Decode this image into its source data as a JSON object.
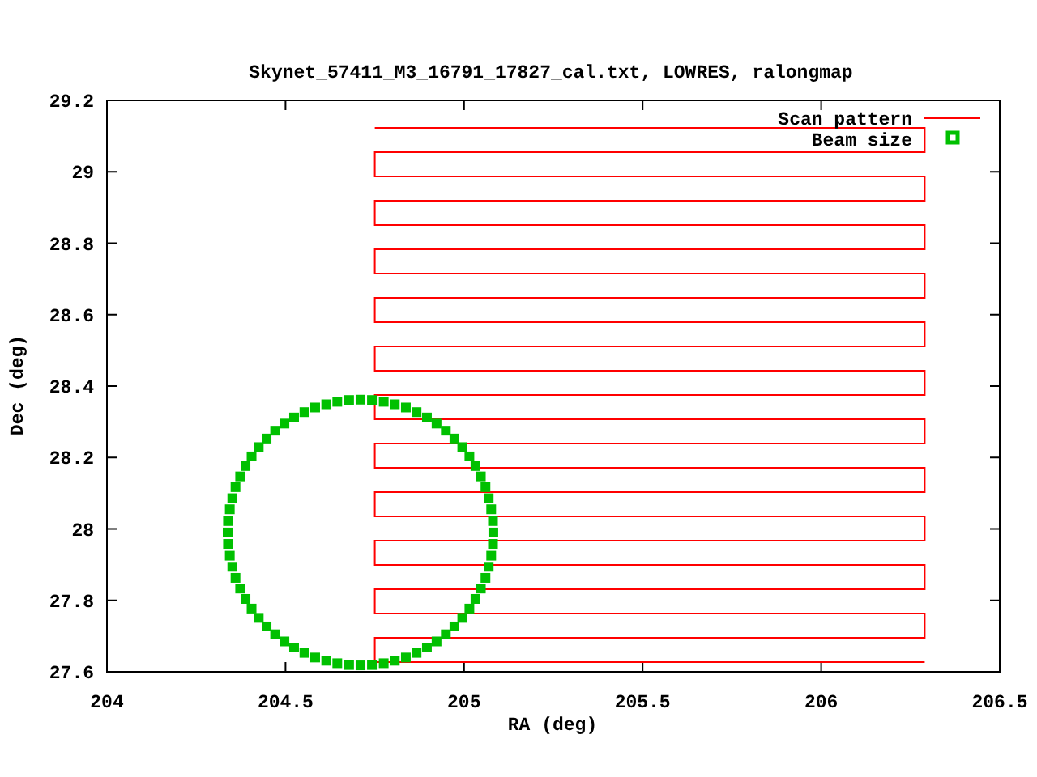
{
  "chart_data": {
    "type": "line",
    "title": "Skynet_57411_M3_16791_17827_cal.txt, LOWRES, ralongmap",
    "legend": true,
    "xlabel": "RA (deg)",
    "ylabel": "Dec (deg)",
    "xlim": [
      204,
      206.5
    ],
    "ylim": [
      27.6,
      29.2
    ],
    "xticks": [
      {
        "value": 204,
        "label": "204"
      },
      {
        "value": 204.5,
        "label": "204.5"
      },
      {
        "value": 205,
        "label": "205"
      },
      {
        "value": 205.5,
        "label": "205.5"
      },
      {
        "value": 206,
        "label": "206"
      },
      {
        "value": 206.5,
        "label": "206.5"
      }
    ],
    "yticks": [
      {
        "value": 27.6,
        "label": "27.6"
      },
      {
        "value": 27.8,
        "label": "27.8"
      },
      {
        "value": 28,
        "label": "28"
      },
      {
        "value": 28.2,
        "label": "28.2"
      },
      {
        "value": 28.4,
        "label": "28.4"
      },
      {
        "value": 28.6,
        "label": "28.6"
      },
      {
        "value": 28.8,
        "label": "28.8"
      },
      {
        "value": 29,
        "label": "29"
      },
      {
        "value": 29.2,
        "label": "29.2"
      }
    ],
    "x": [
      204.75,
      206.29,
      206.29,
      204.75,
      204.75,
      206.29,
      206.29,
      204.75,
      204.75,
      206.29,
      206.29,
      204.75,
      204.75,
      206.29,
      206.29,
      204.75,
      204.75,
      206.29,
      206.29,
      204.75,
      204.75,
      206.29,
      206.29,
      204.75,
      204.75,
      206.29,
      206.29,
      204.75,
      204.75,
      206.29,
      206.29,
      204.75,
      204.75,
      206.29,
      206.29,
      204.75,
      204.75,
      206.29,
      206.29,
      204.75,
      204.75,
      206.29,
      206.29,
      204.75,
      204.75,
      206.29,
      205.082,
      205.081,
      205.076,
      205.069,
      205.06,
      205.047,
      205.032,
      205.015,
      204.995,
      204.973,
      204.949,
      204.923,
      204.896,
      204.867,
      204.837,
      204.806,
      204.775,
      204.742,
      204.71,
      204.678,
      204.645,
      204.614,
      204.583,
      204.553,
      204.524,
      204.497,
      204.471,
      204.447,
      204.425,
      204.405,
      204.388,
      204.373,
      204.36,
      204.351,
      204.344,
      204.339,
      204.338,
      204.339,
      204.344,
      204.351,
      204.36,
      204.373,
      204.388,
      204.405,
      204.425,
      204.447,
      204.471,
      204.497,
      204.524,
      204.553,
      204.583,
      204.614,
      204.645,
      204.678,
      204.71,
      204.742,
      204.775,
      204.806,
      204.837,
      204.867,
      204.896,
      204.923,
      204.949,
      204.973,
      204.995,
      205.015,
      205.032,
      205.047,
      205.06,
      205.069,
      205.076,
      205.081
    ],
    "series": [
      {
        "name": "Scan pattern",
        "color": "#ff0000",
        "type": "line",
        "values": [
          29.123,
          29.123,
          29.055,
          29.055,
          28.987,
          28.987,
          28.919,
          28.919,
          28.851,
          28.851,
          28.783,
          28.783,
          28.715,
          28.715,
          28.647,
          28.647,
          28.579,
          28.579,
          28.511,
          28.511,
          28.443,
          28.443,
          28.375,
          28.375,
          28.307,
          28.307,
          28.239,
          28.239,
          28.171,
          28.171,
          28.103,
          28.103,
          28.035,
          28.035,
          27.967,
          27.967,
          27.899,
          27.899,
          27.831,
          27.831,
          27.763,
          27.763,
          27.695,
          27.695,
          27.627,
          27.627,
          null,
          null,
          null,
          null,
          null,
          null,
          null,
          null,
          null,
          null,
          null,
          null,
          null,
          null,
          null,
          null,
          null,
          null,
          null,
          null,
          null,
          null,
          null,
          null,
          null,
          null,
          null,
          null,
          null,
          null,
          null,
          null,
          null,
          null,
          null,
          null,
          null,
          null,
          null,
          null,
          null,
          null,
          null,
          null,
          null,
          null,
          null,
          null,
          null,
          null,
          null,
          null,
          null,
          null,
          null,
          null,
          null,
          null,
          null,
          null,
          null,
          null,
          null,
          null,
          null,
          null,
          null,
          null,
          null,
          null,
          null,
          null
        ]
      },
      {
        "name": "Beam size",
        "color": "#00c000",
        "type": "scatter",
        "values": [
          null,
          null,
          null,
          null,
          null,
          null,
          null,
          null,
          null,
          null,
          null,
          null,
          null,
          null,
          null,
          null,
          null,
          null,
          null,
          null,
          null,
          null,
          null,
          null,
          null,
          null,
          null,
          null,
          null,
          null,
          null,
          null,
          null,
          null,
          null,
          null,
          null,
          null,
          null,
          null,
          null,
          null,
          null,
          null,
          null,
          null,
          27.99,
          28.022,
          28.055,
          28.086,
          28.117,
          28.147,
          28.176,
          28.203,
          28.229,
          28.253,
          28.275,
          28.295,
          28.312,
          28.327,
          28.34,
          28.349,
          28.356,
          28.361,
          28.362,
          28.361,
          28.356,
          28.349,
          28.34,
          28.327,
          28.312,
          28.295,
          28.275,
          28.253,
          28.229,
          28.203,
          28.176,
          28.147,
          28.117,
          28.086,
          28.055,
          28.022,
          27.99,
          27.958,
          27.925,
          27.894,
          27.863,
          27.833,
          27.804,
          27.777,
          27.751,
          27.727,
          27.705,
          27.685,
          27.668,
          27.653,
          27.64,
          27.631,
          27.624,
          27.619,
          27.618,
          27.619,
          27.624,
          27.631,
          27.64,
          27.653,
          27.668,
          27.685,
          27.705,
          27.727,
          27.751,
          27.777,
          27.804,
          27.833,
          27.863,
          27.894,
          27.925,
          27.958
        ]
      }
    ]
  }
}
